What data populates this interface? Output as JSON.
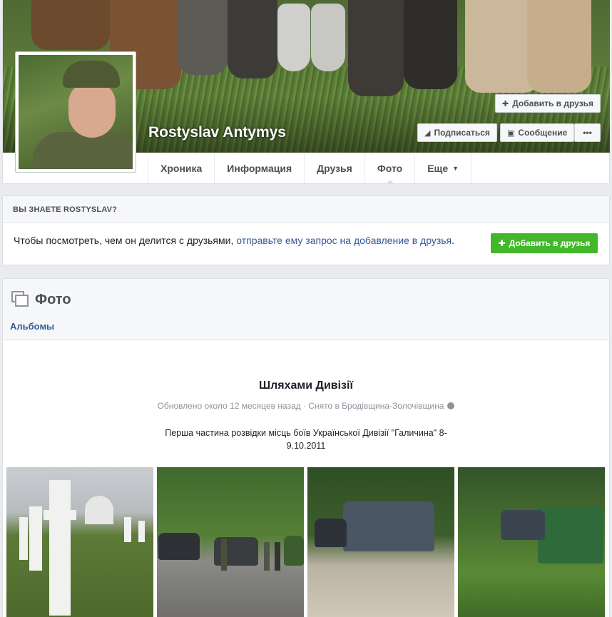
{
  "profile": {
    "name": "Rostyslav Antymys",
    "add_friend_label": "Добавить в друзья",
    "subscribe_label": "Подписаться",
    "message_label": "Сообщение",
    "more_label": "•••"
  },
  "tabs": [
    {
      "label": "Хроника"
    },
    {
      "label": "Информация"
    },
    {
      "label": "Друзья"
    },
    {
      "label": "Фото"
    },
    {
      "label": "Еще"
    }
  ],
  "know_box": {
    "heading": "ВЫ ЗНАЕТЕ ROSTYSLAV?",
    "text": "Чтобы посмотреть, чем он делится с друзьями, ",
    "link": "отправьте ему запрос на добавление в друзья",
    "suffix": ".",
    "button_label": "Добавить в друзья"
  },
  "photos": {
    "title": "Фото",
    "albums_link": "Альбомы",
    "album": {
      "title": "Шляхами Дивізії",
      "meta": "Обновлено около 12 месяцев назад · Снято в Бродівщина-Золочівщина",
      "description": "Перша частина розвідки місць боїв Української Дивізії \"Галичина\" 8-9.10.2011"
    }
  },
  "colors": {
    "link": "#365899",
    "green_button": "#42b72a",
    "page_bg": "#e9ebee"
  },
  "icons": [
    "add-friend-icon",
    "rss-icon",
    "message-icon",
    "photos-icon",
    "globe-icon",
    "caret-down-icon"
  ]
}
